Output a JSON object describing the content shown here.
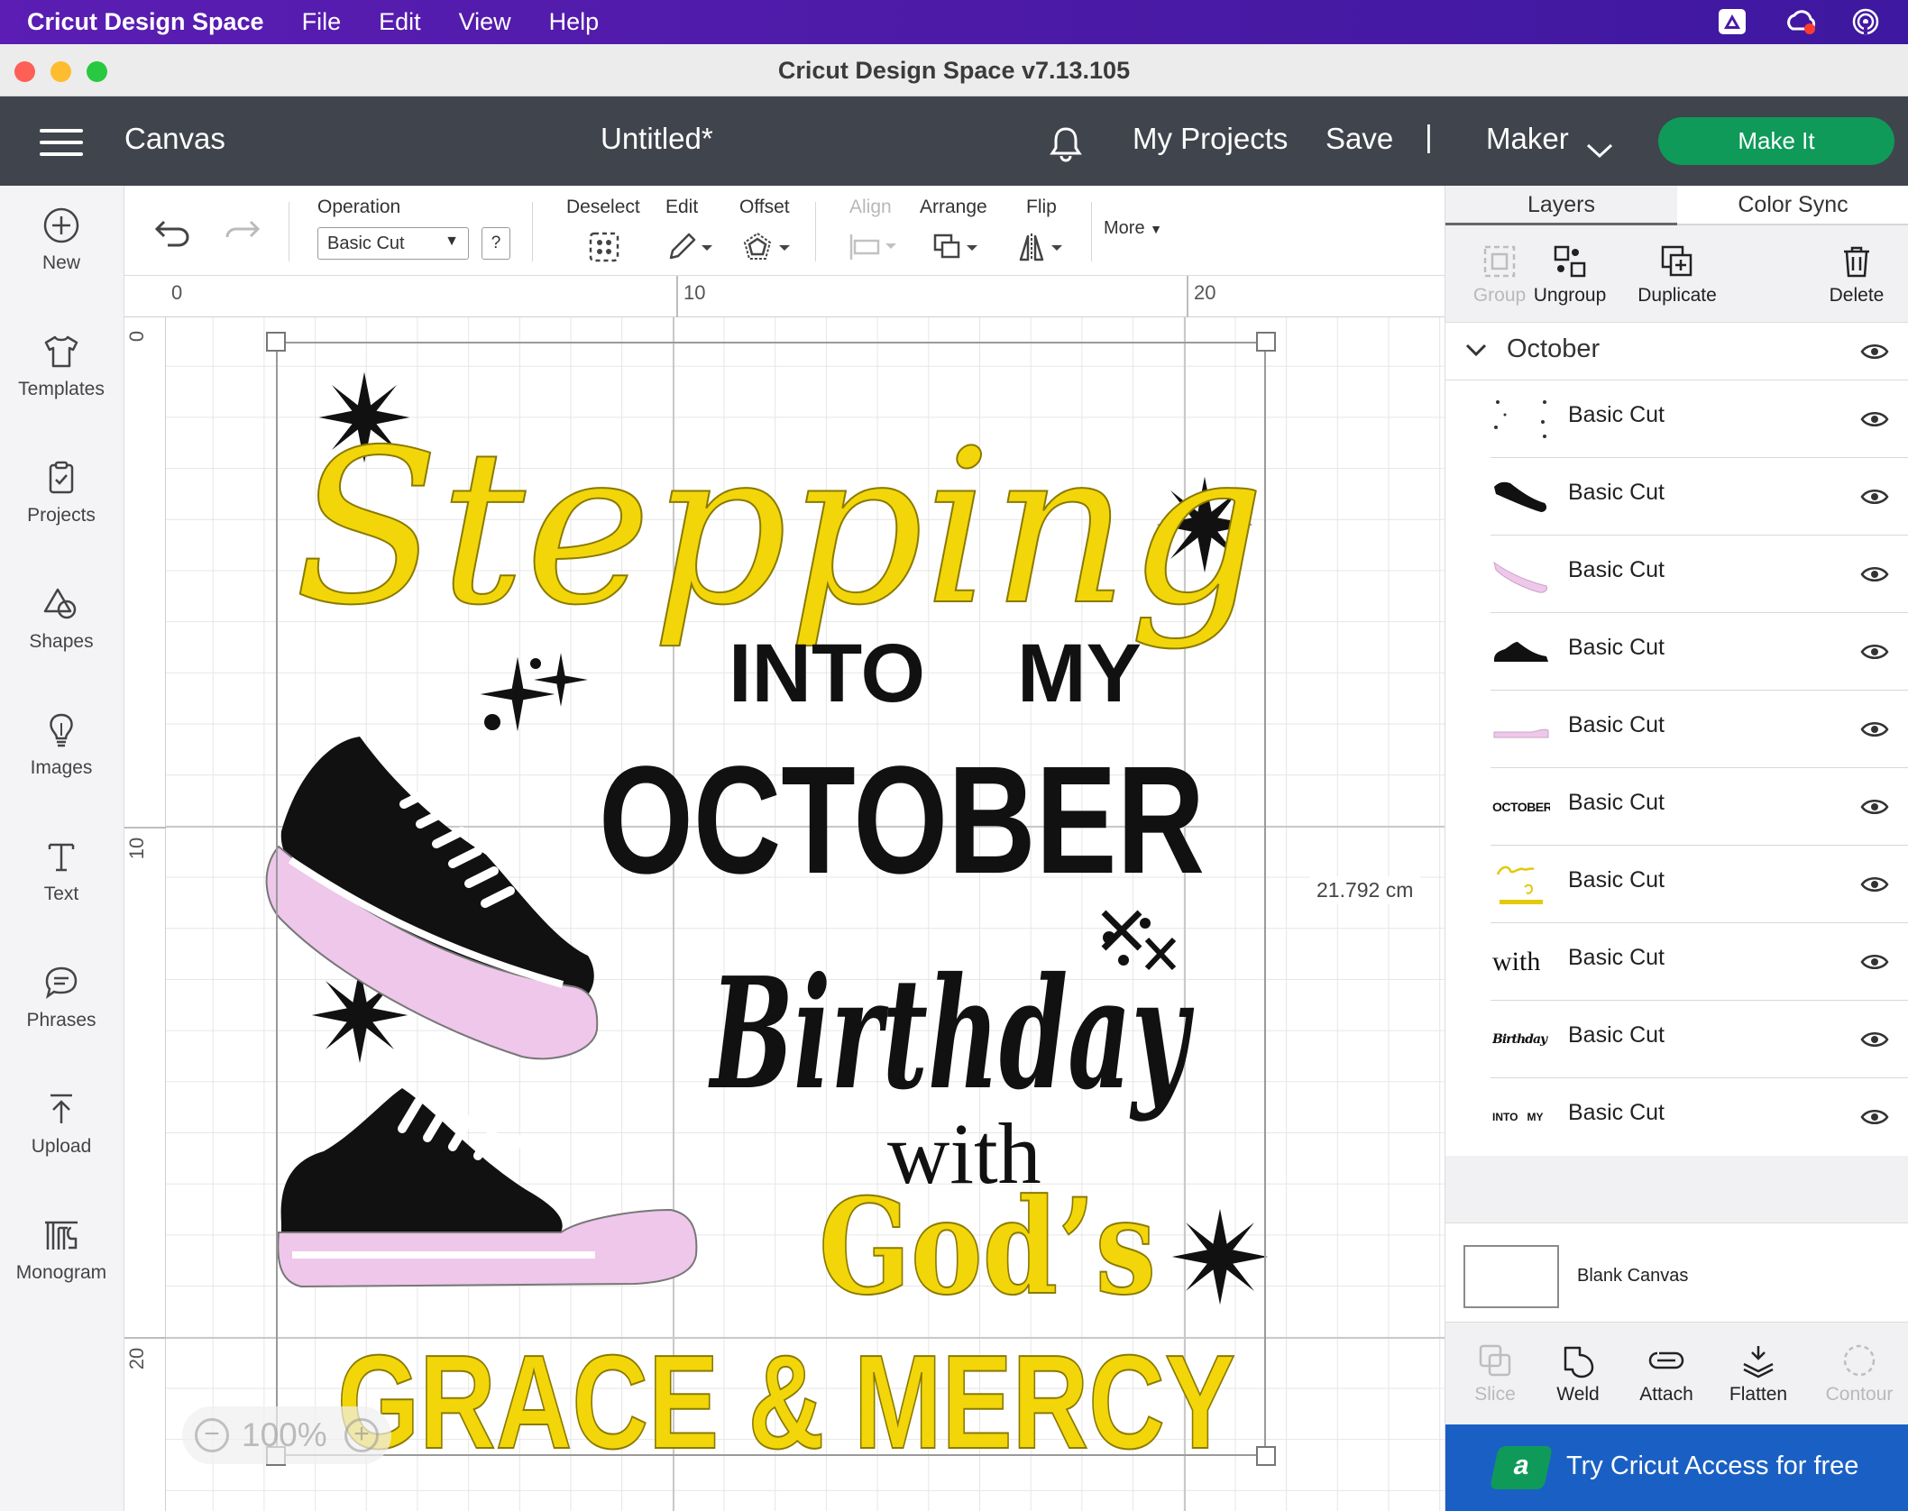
{
  "menubar": {
    "app_name": "Cricut Design Space",
    "items": [
      "File",
      "Edit",
      "View",
      "Help"
    ]
  },
  "window": {
    "title": "Cricut Design Space  v7.13.105"
  },
  "header": {
    "section": "Canvas",
    "document_title": "Untitled*",
    "my_projects": "My Projects",
    "save": "Save",
    "separator": "|",
    "machine": "Maker",
    "make_it": "Make It"
  },
  "sidebar": {
    "items": [
      {
        "label": "New",
        "icon": "plus-circle-icon"
      },
      {
        "label": "Templates",
        "icon": "tshirt-icon"
      },
      {
        "label": "Projects",
        "icon": "clipboard-icon"
      },
      {
        "label": "Shapes",
        "icon": "shapes-icon"
      },
      {
        "label": "Images",
        "icon": "lightbulb-icon"
      },
      {
        "label": "Text",
        "icon": "text-icon"
      },
      {
        "label": "Phrases",
        "icon": "speech-bubble-icon"
      },
      {
        "label": "Upload",
        "icon": "upload-icon"
      },
      {
        "label": "Monogram",
        "icon": "monogram-icon"
      }
    ]
  },
  "toolbar": {
    "operation_label": "Operation",
    "operation_value": "Basic Cut",
    "help": "?",
    "deselect": "Deselect",
    "edit": "Edit",
    "offset": "Offset",
    "align": "Align",
    "arrange": "Arrange",
    "flip": "Flip",
    "more": "More"
  },
  "rulers": {
    "top": [
      "0",
      "10",
      "20"
    ],
    "left": [
      "0",
      "10",
      "20"
    ]
  },
  "canvas": {
    "dimension_label": "21.792 cm",
    "zoom": "100%",
    "design_text": {
      "stepping": "Stepping",
      "into": "INTO",
      "my": "MY",
      "october": "OCTOBER",
      "birthday": "Birthday",
      "with": "with",
      "gods": "God’s",
      "grace": "GRACE & MERCY"
    }
  },
  "panel": {
    "tabs": [
      "Layers",
      "Color Sync"
    ],
    "tools": [
      {
        "label": "Group",
        "enabled": false
      },
      {
        "label": "Ungroup",
        "enabled": true
      },
      {
        "label": "Duplicate",
        "enabled": true
      },
      {
        "label": "Delete",
        "enabled": true
      }
    ],
    "group_name": "October",
    "layers": [
      {
        "name": "Basic Cut",
        "thumb": "stars"
      },
      {
        "name": "Basic Cut",
        "thumb": "shoe-black-1"
      },
      {
        "name": "Basic Cut",
        "thumb": "sole-pink-1"
      },
      {
        "name": "Basic Cut",
        "thumb": "shoe-black-2"
      },
      {
        "name": "Basic Cut",
        "thumb": "sole-pink-2"
      },
      {
        "name": "Basic Cut",
        "thumb": "october-text",
        "thumb_text": "OCTOBER"
      },
      {
        "name": "Basic Cut",
        "thumb": "yellow-text"
      },
      {
        "name": "Basic Cut",
        "thumb": "with-text",
        "thumb_text": "with"
      },
      {
        "name": "Basic Cut",
        "thumb": "birthday-text",
        "thumb_text": "Birthday"
      },
      {
        "name": "Basic Cut",
        "thumb": "into-my-text",
        "thumb_text": "INTO   MY"
      }
    ],
    "blank_canvas": "Blank Canvas",
    "bottom_tools": [
      {
        "label": "Slice",
        "enabled": false
      },
      {
        "label": "Weld",
        "enabled": true
      },
      {
        "label": "Attach",
        "enabled": true
      },
      {
        "label": "Flatten",
        "enabled": true
      },
      {
        "label": "Contour",
        "enabled": false
      }
    ],
    "access_banner": "Try Cricut Access for free",
    "access_logo": "a"
  },
  "colors": {
    "menubar": "#4b1aa6",
    "header": "#40444c",
    "make_it": "#0f9a5a",
    "access_banner": "#1a60c4",
    "design_yellow": "#f2d60a",
    "design_pink": "#eec7ea",
    "design_black": "#111111"
  }
}
